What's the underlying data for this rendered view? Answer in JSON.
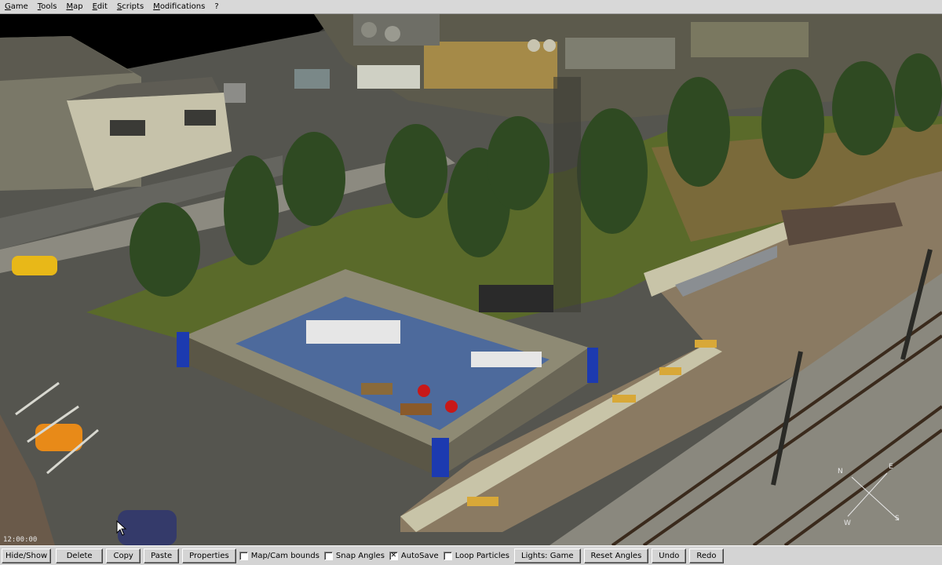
{
  "menu": {
    "items": [
      "Game",
      "Tools",
      "Map",
      "Edit",
      "Scripts",
      "Modifications",
      "?"
    ]
  },
  "viewport": {
    "game_clock": "12:00:00",
    "compass": {
      "n": "N",
      "e": "E",
      "s": "S",
      "w": "W"
    }
  },
  "toolbar": {
    "hide_show": "Hide/Show",
    "delete": "Delete",
    "copy": "Copy",
    "paste": "Paste",
    "properties": "Properties",
    "map_cam_bounds": {
      "label": "Map/Cam bounds",
      "checked": false
    },
    "snap_angles": {
      "label": "Snap Angles",
      "checked": false
    },
    "autosave": {
      "label": "AutoSave",
      "checked": true
    },
    "loop_particles": {
      "label": "Loop Particles",
      "checked": false
    },
    "lights": "Lights: Game",
    "reset_angles": "Reset Angles",
    "undo": "Undo",
    "redo": "Redo"
  },
  "colors": {
    "menu_bg": "#d8d8d8",
    "toolbar_bg": "#d4d4d4",
    "grass": "#5a6a2a",
    "asphalt": "#55554f",
    "floor": "#4d6a9c",
    "platform": "#8a7a62"
  }
}
